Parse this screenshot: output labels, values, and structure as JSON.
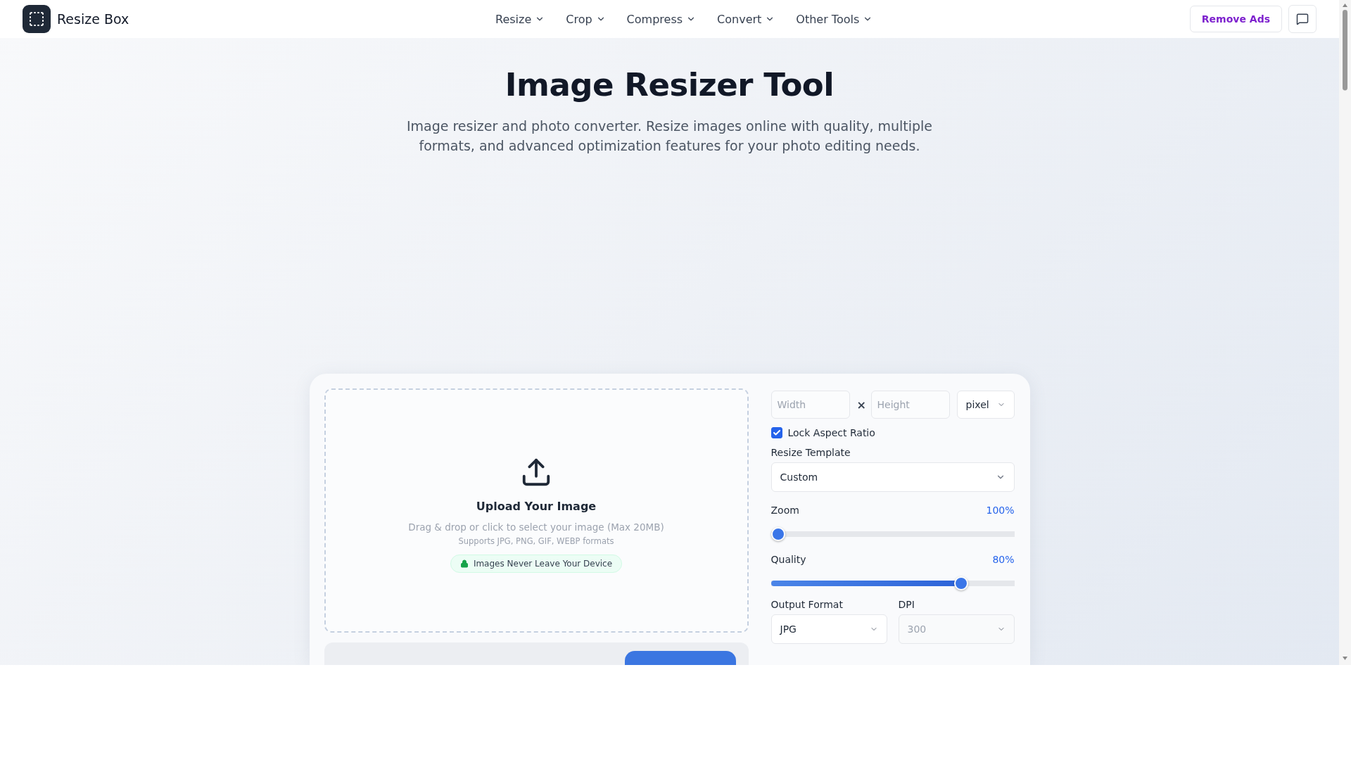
{
  "header": {
    "brand": "Resize Box",
    "nav": [
      {
        "label": "Resize"
      },
      {
        "label": "Crop"
      },
      {
        "label": "Compress"
      },
      {
        "label": "Convert"
      },
      {
        "label": "Other Tools"
      }
    ],
    "remove_ads": "Remove Ads"
  },
  "hero": {
    "title": "Image Resizer Tool",
    "subtitle": "Image resizer and photo converter. Resize images online with quality, multiple formats, and advanced optimization features for your photo editing needs."
  },
  "upload": {
    "title": "Upload Your Image",
    "hint": "Drag & drop or click to select your image (Max 20MB)",
    "formats": "Supports JPG, PNG, GIF, WEBP formats",
    "badge": "Images Never Leave Your Device"
  },
  "settings": {
    "width": {
      "placeholder": "Width"
    },
    "times": "×",
    "height": {
      "placeholder": "Height"
    },
    "unit": "pixel",
    "lock": {
      "label": "Lock Aspect Ratio",
      "checked": true
    },
    "template": {
      "label": "Resize Template",
      "value": "Custom"
    },
    "sliders": [
      {
        "label": "Zoom",
        "reading": "100%",
        "level": 0
      },
      {
        "label": "Quality",
        "reading": "80%",
        "level": 0.8
      }
    ],
    "format": {
      "label": "Output Format",
      "value": "JPG",
      "disabled": false
    },
    "dpi": {
      "label": "DPI",
      "value": "300",
      "disabled": true
    }
  }
}
